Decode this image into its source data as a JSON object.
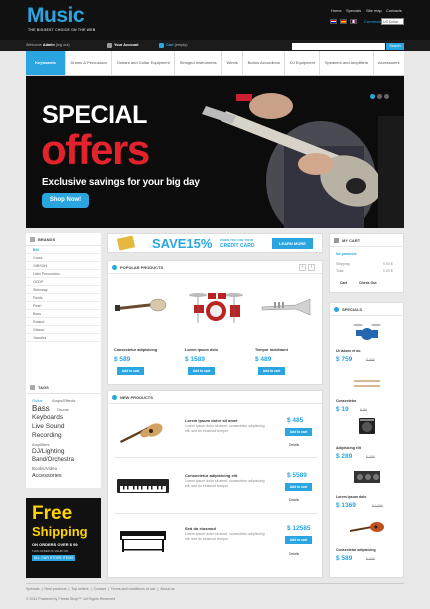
{
  "header": {
    "logo": "Music",
    "tagline": "THE BIGGEST CHOICE ON THE WEB",
    "top_links": [
      "Home",
      "Specials",
      "Site map",
      "Contacts"
    ],
    "currency_label": "Currencies:",
    "currency_value": "US Dollar",
    "welcome_prefix": "Welcome",
    "welcome_user": "Admin",
    "welcome_suffix": "(log out)",
    "account_label": "Your Account",
    "cart_label": "Cart",
    "cart_state": "(empty)",
    "search_button": "Search"
  },
  "nav": [
    "Keyboards",
    "Drums & Percussion",
    "Guitars and Guitar Equipment",
    "Stringed Instruments",
    "Winds",
    "Button Accordions",
    "DJ Equipment",
    "Speakers and Amplifiers",
    "Accessories"
  ],
  "banner": {
    "line1": "SPECIAL",
    "line2": "offers",
    "line3": "Exclusive savings for your big day",
    "button": "Shop Now!"
  },
  "brands": {
    "title": "BRANDS",
    "items": [
      "Bbl",
      "Cross",
      "GIBSON",
      "Latin Percussion",
      "OCDP",
      "Steinway",
      "Fields",
      "Pearl",
      "Boss",
      "Roland",
      "Gibson",
      "Yamaha"
    ]
  },
  "tags": {
    "title": "TAGS",
    "items": [
      "Guitar",
      "Amps/Effects",
      "Bass",
      "Drums",
      "Keyboards",
      "Live Sound",
      "Recording",
      "Amplifiers",
      "DJ/Lighting",
      "Band/Orchestra",
      "Books/Video",
      "Accessories"
    ]
  },
  "free_shipping": {
    "line1": "Free",
    "line2": "Shipping",
    "line3": "ON ORDERS OVER $ 99",
    "line4": "THIS OFFER IS VALID ON",
    "line5": "ALL OUR STORE ITEMS"
  },
  "promo": {
    "save": "SAVE15%",
    "when": "WHEN YOU USE YOUR",
    "card": "CREDIT CARD",
    "button": "LEARN MORE"
  },
  "popular": {
    "title": "POPULAR PRODUCTS",
    "products": [
      {
        "name": "Consectetur adipisicing",
        "price": "$ 589",
        "button": "Add to cart"
      },
      {
        "name": "Lorem ipsum dolo",
        "price": "$ 1589",
        "button": "Add to cart"
      },
      {
        "name": "Tempor incididunt",
        "price": "$ 489",
        "button": "Add to cart"
      }
    ]
  },
  "new_products": {
    "title": "NEW PRODUCTS",
    "products": [
      {
        "name": "Lorem ipsum dolor sit amet",
        "desc": "Lorem ipsum dolor sit amet, consectetur adipisicing elit, sed do eiusmod tempor",
        "price": "$ 485",
        "button": "Add to cart",
        "details": "Details"
      },
      {
        "name": "Consectetur adipisicing elit",
        "desc": "Lorem ipsum dolor sit amet, consectetur adipisicing elit, sed do eiusmod tempor",
        "price": "$ 5589",
        "button": "Add to cart",
        "details": "Details"
      },
      {
        "name": "Sed do eiusmod",
        "desc": "Lorem ipsum dolor sit amet, consectetur adipisicing elit, sed do eiusmod tempor",
        "price": "$ 12585",
        "button": "Add to cart",
        "details": "Details"
      }
    ]
  },
  "cart": {
    "title": "MY CART",
    "status": "No products",
    "shipping_label": "Shipping",
    "shipping_value": "0.00 $",
    "total_label": "Total",
    "total_value": "0.00 $",
    "cart_button": "Cart",
    "checkout_button": "Check Out"
  },
  "specials": {
    "title": "SPECIALS",
    "items": [
      {
        "name": "Ut labore et do",
        "price": "$ 759",
        "old": "$ 899"
      },
      {
        "name": "Consectetur",
        "price": "$ 19",
        "old": "$ 89"
      },
      {
        "name": "Adipisicing elit",
        "price": "$ 289",
        "old": "$ 289"
      },
      {
        "name": "Lorem ipsum dolo",
        "price": "$ 1369",
        "old": "$ 1455"
      },
      {
        "name": "Consectetur adipisicing",
        "price": "$ 589",
        "old": "$ 589"
      }
    ]
  },
  "footer": {
    "links": [
      "Specials",
      "New products",
      "Top sellers",
      "Contact",
      "Terms and conditions of use",
      "About us"
    ],
    "copyright": "© 2011 Powered by Presta Shop™. All Rights Reserved"
  },
  "colors": {
    "accent": "#2aa5e0",
    "red": "#e3232c",
    "yellow": "#ffd400",
    "dark": "#111111"
  }
}
